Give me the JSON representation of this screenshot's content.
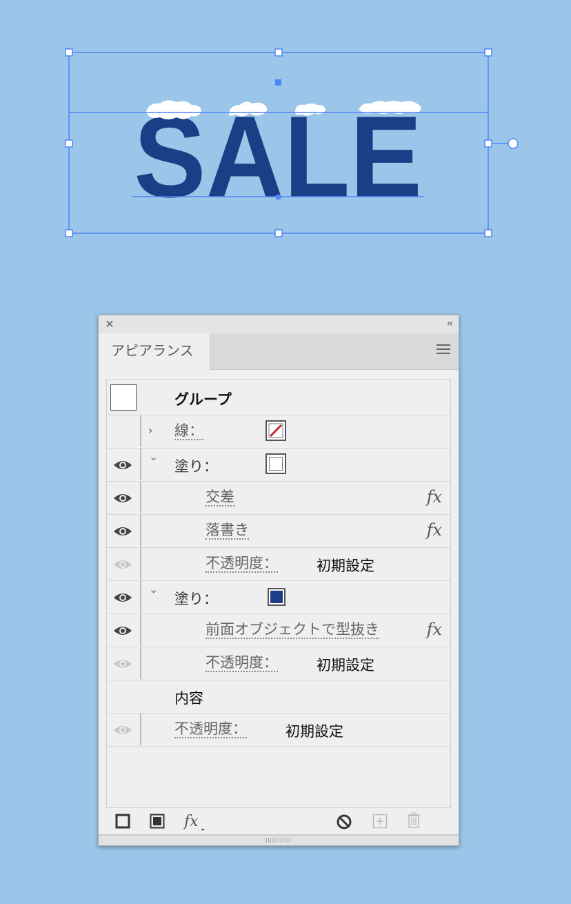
{
  "canvas": {
    "sale_text": "SALE",
    "text_color": "#1b3f87",
    "snow_color": "#ffffff",
    "selection_color": "#4f86f7"
  },
  "panel": {
    "tab_label": "アピアランス",
    "rows": {
      "group": {
        "label": "グループ"
      },
      "stroke": {
        "label": "線：",
        "swatch": "none"
      },
      "fill1": {
        "label": "塗り：",
        "swatch": "#ffffff"
      },
      "effect_intersect": {
        "label": "交差",
        "fx": "fx"
      },
      "effect_scribble": {
        "label": "落書き",
        "fx": "fx"
      },
      "opacity1": {
        "label": "不透明度：",
        "value": "初期設定"
      },
      "fill2": {
        "label": "塗り：",
        "swatch": "#1b3f87"
      },
      "effect_minus_front": {
        "label": "前面オブジェクトで型抜き",
        "fx": "fx"
      },
      "opacity2": {
        "label": "不透明度：",
        "value": "初期設定"
      },
      "contents": {
        "label": "内容"
      },
      "opacity3": {
        "label": "不透明度：",
        "value": "初期設定"
      }
    },
    "footer": {
      "icons": [
        "add-stroke-icon",
        "add-fill-icon",
        "fx-menu-icon",
        "clear-appearance-icon",
        "duplicate-item-icon",
        "trash-icon"
      ]
    }
  }
}
